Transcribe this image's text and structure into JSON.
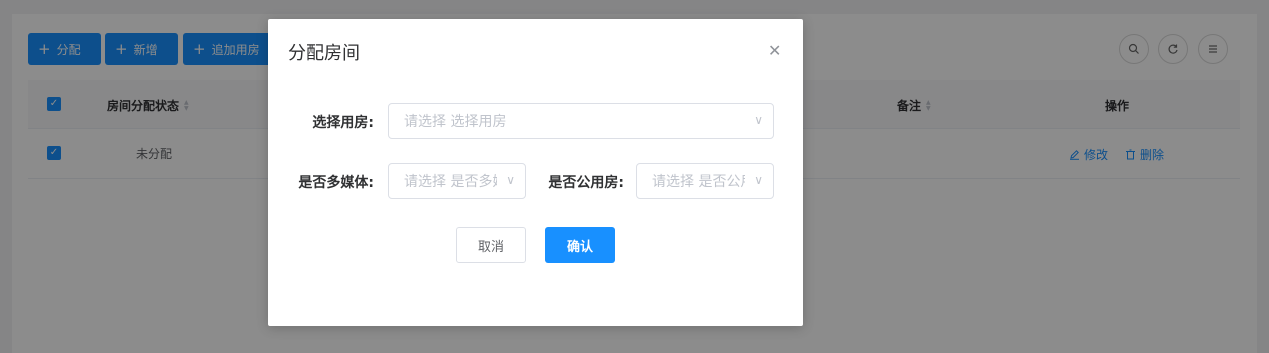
{
  "toolbar": {
    "assign_label": "分配",
    "add_label": "新增",
    "append_label": "追加用房"
  },
  "tools": {
    "search_icon": "search-icon",
    "refresh_icon": "refresh-icon",
    "filter_icon": "filter-icon"
  },
  "table": {
    "headers": {
      "status": "房间分配状态",
      "remark": "备注",
      "actions": "操作"
    },
    "rows": [
      {
        "status": "未分配",
        "edit": "修改",
        "delete": "删除"
      }
    ]
  },
  "dialog": {
    "title": "分配房间",
    "room_label": "选择用房:",
    "room_placeholder": "请选择 选择用房",
    "multimedia_label": "是否多媒体:",
    "multimedia_placeholder": "请选择 是否多媒体",
    "public_label": "是否公用房:",
    "public_placeholder": "请选择 是否公用房",
    "cancel_label": "取消",
    "confirm_label": "确认"
  },
  "colors": {
    "primary": "#1890ff",
    "mask": "rgba(0,0,0,0.45)"
  }
}
